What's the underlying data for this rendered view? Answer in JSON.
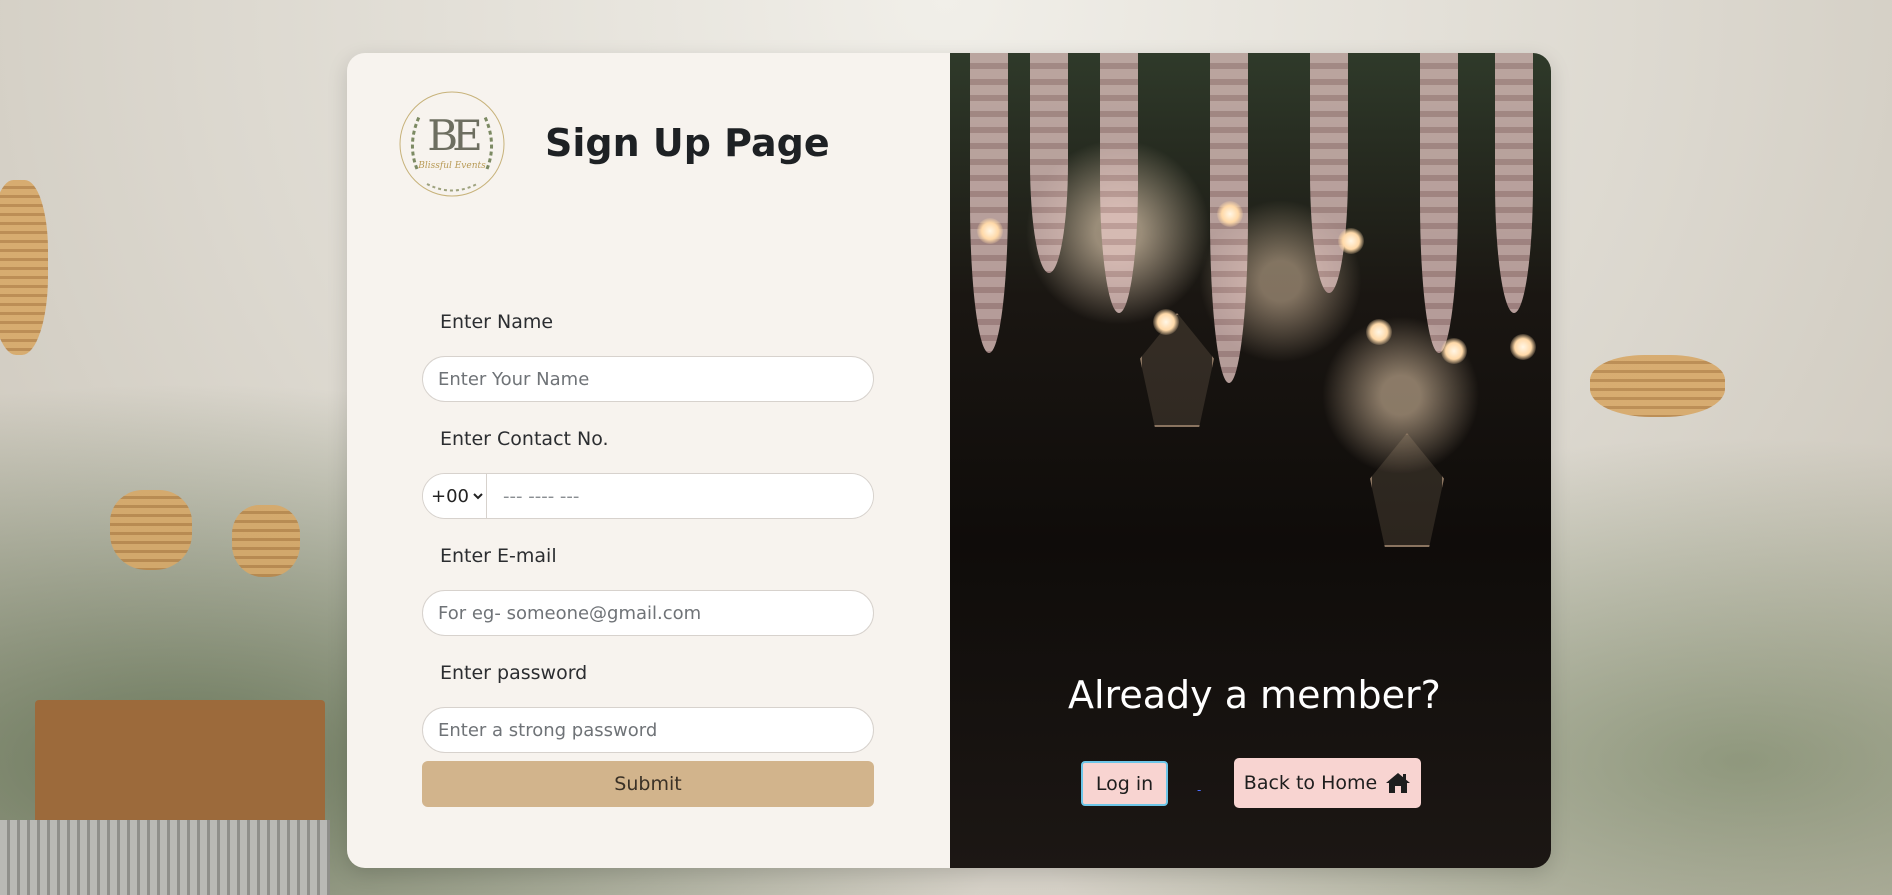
{
  "header": {
    "title": "Sign Up Page",
    "logo_monogram": "BE",
    "logo_script": "Blissful Events"
  },
  "form": {
    "name_label": "Enter Name",
    "name_placeholder": "Enter Your Name",
    "contact_label": "Enter Contact No.",
    "country_code": "+00",
    "contact_placeholder": "--- ---- ---",
    "email_label": "Enter E-mail",
    "email_placeholder": "For eg- someone@gmail.com",
    "password_label": "Enter password",
    "password_placeholder": "Enter a strong password",
    "submit_label": "Submit"
  },
  "aside": {
    "heading": "Already a member?",
    "login_label": "Log in",
    "separator": "-",
    "home_label": "Back to Home",
    "home_icon": "home-icon"
  },
  "colors": {
    "panel_bg": "#f7f3ee",
    "submit_bg": "#d2b48c",
    "button_pink": "#f8d4d1",
    "login_border": "#6ec6e8"
  }
}
